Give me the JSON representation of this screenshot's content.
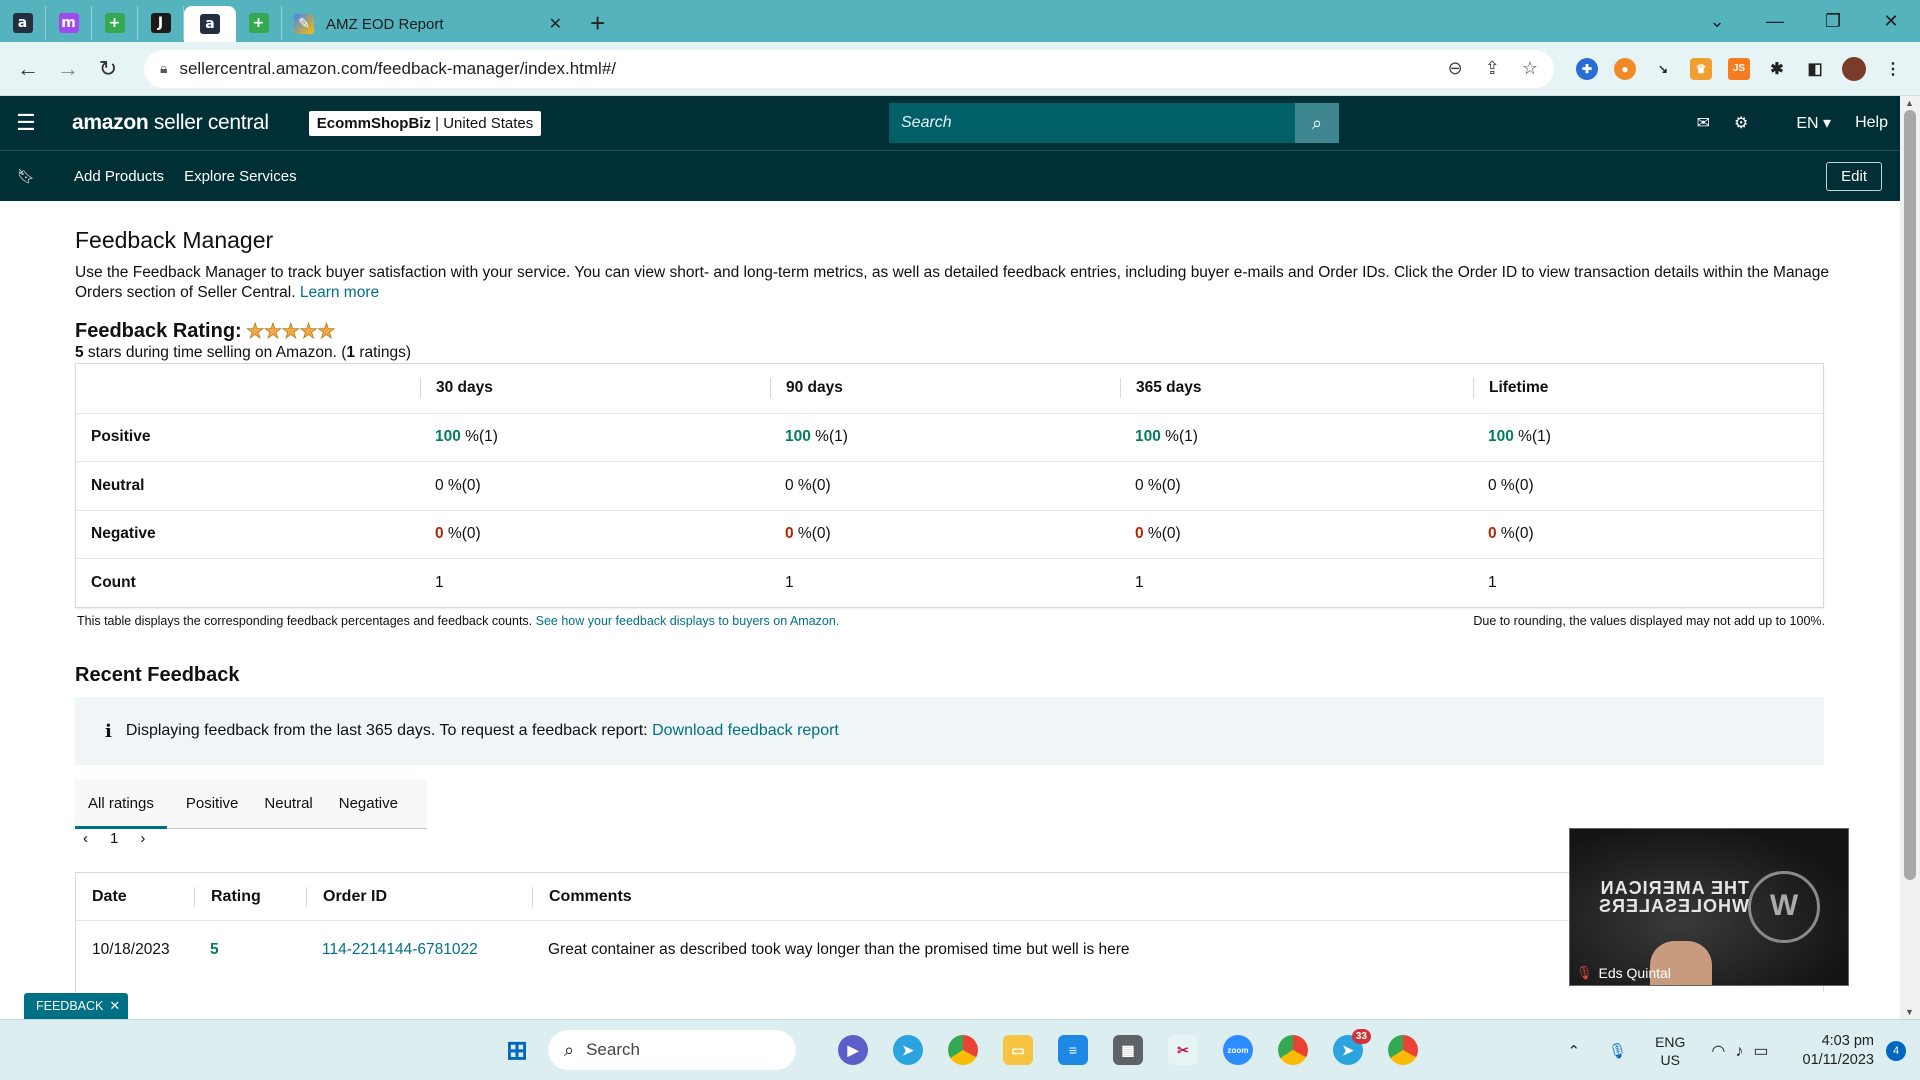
{
  "browser": {
    "tabs": [
      {
        "icon": "amazon-icon",
        "letter": "a",
        "color": "#232f3e"
      },
      {
        "icon": "messenger-icon",
        "letter": "m",
        "color": "#a04bf0"
      },
      {
        "icon": "sheets-icon",
        "letter": "+",
        "color": "#34a853"
      },
      {
        "icon": "sellerapp-icon",
        "letter": "J",
        "color": "#1a1a1a"
      },
      {
        "icon": "amazon-icon",
        "letter": "a",
        "color": "#232f3e"
      },
      {
        "icon": "sheets-icon",
        "letter": "+",
        "color": "#34a853"
      }
    ],
    "active_tab_title": "AMZ EOD Report",
    "url": "sellercentral.amazon.com/feedback-manager/index.html#/"
  },
  "header": {
    "logo_a": "amazon",
    "logo_b": " seller central",
    "store_name": "EcommShopBiz",
    "store_sep": " | ",
    "store_region": "United States",
    "search_placeholder": "Search",
    "lang": "EN",
    "help": "Help"
  },
  "subnav": {
    "items": [
      "Add Products",
      "Explore Services"
    ],
    "edit": "Edit"
  },
  "page": {
    "title": "Feedback Manager",
    "description": "Use the Feedback Manager to track buyer satisfaction with your service. You can view short- and long-term metrics, as well as detailed feedback entries, including buyer e-mails and Order IDs. Click the Order ID to view transaction details within the Manage Orders section of Seller Central.",
    "learn_more": "Learn more",
    "rating_label": "Feedback Rating:",
    "rating_stars": 5,
    "rating_sub_stars": "5",
    "rating_sub_a": " stars during time selling on Amazon. (",
    "rating_sub_count": "1",
    "rating_sub_b": " ratings)"
  },
  "feedback_table": {
    "columns": [
      "",
      "30 days",
      "90 days",
      "365 days",
      "Lifetime"
    ],
    "rows": [
      {
        "label": "Positive",
        "cells": [
          {
            "v": "100",
            "s": " %(1)"
          },
          {
            "v": "100",
            "s": " %(1)"
          },
          {
            "v": "100",
            "s": " %(1)"
          },
          {
            "v": "100",
            "s": " %(1)"
          }
        ]
      },
      {
        "label": "Neutral",
        "cells": [
          {
            "v": "0",
            "s": " %(0)"
          },
          {
            "v": "0",
            "s": " %(0)"
          },
          {
            "v": "0",
            "s": " %(0)"
          },
          {
            "v": "0",
            "s": " %(0)"
          }
        ]
      },
      {
        "label": "Negative",
        "cells": [
          {
            "v": "0",
            "s": " %(0)"
          },
          {
            "v": "0",
            "s": " %(0)"
          },
          {
            "v": "0",
            "s": " %(0)"
          },
          {
            "v": "0",
            "s": " %(0)"
          }
        ]
      },
      {
        "label": "Count",
        "cells": [
          {
            "v": "1",
            "s": ""
          },
          {
            "v": "1",
            "s": ""
          },
          {
            "v": "1",
            "s": ""
          },
          {
            "v": "1",
            "s": ""
          }
        ]
      }
    ],
    "note_left": "This table displays the corresponding feedback percentages and feedback counts.",
    "note_link": "See how your feedback displays to buyers on Amazon.",
    "note_right": "Due to rounding, the values displayed may not add up to 100%."
  },
  "recent": {
    "title": "Recent Feedback",
    "info": "Displaying feedback from the last 365 days. To request a feedback report:",
    "info_link": "Download feedback report",
    "tabs": [
      "All ratings",
      "Positive",
      "Neutral",
      "Negative"
    ],
    "page": "1",
    "columns": [
      "Date",
      "Rating",
      "Order ID",
      "Comments"
    ],
    "rows": [
      {
        "date": "10/18/2023",
        "rating": "5",
        "order_id": "114-2214144-6781022",
        "comment": "Great container as described took way longer than the promised time but well is here"
      }
    ]
  },
  "feedback_tag": "FEEDBACK",
  "video": {
    "name": "Eds Quintal",
    "brand_line1": "THE AMERICAN",
    "brand_line2": "WHOLESALERS"
  },
  "taskbar": {
    "search": "Search",
    "telegram_badge": "33",
    "lang_1": "ENG",
    "lang_2": "US",
    "time": "4:03 pm",
    "date": "01/11/2023",
    "notifications": "4"
  }
}
